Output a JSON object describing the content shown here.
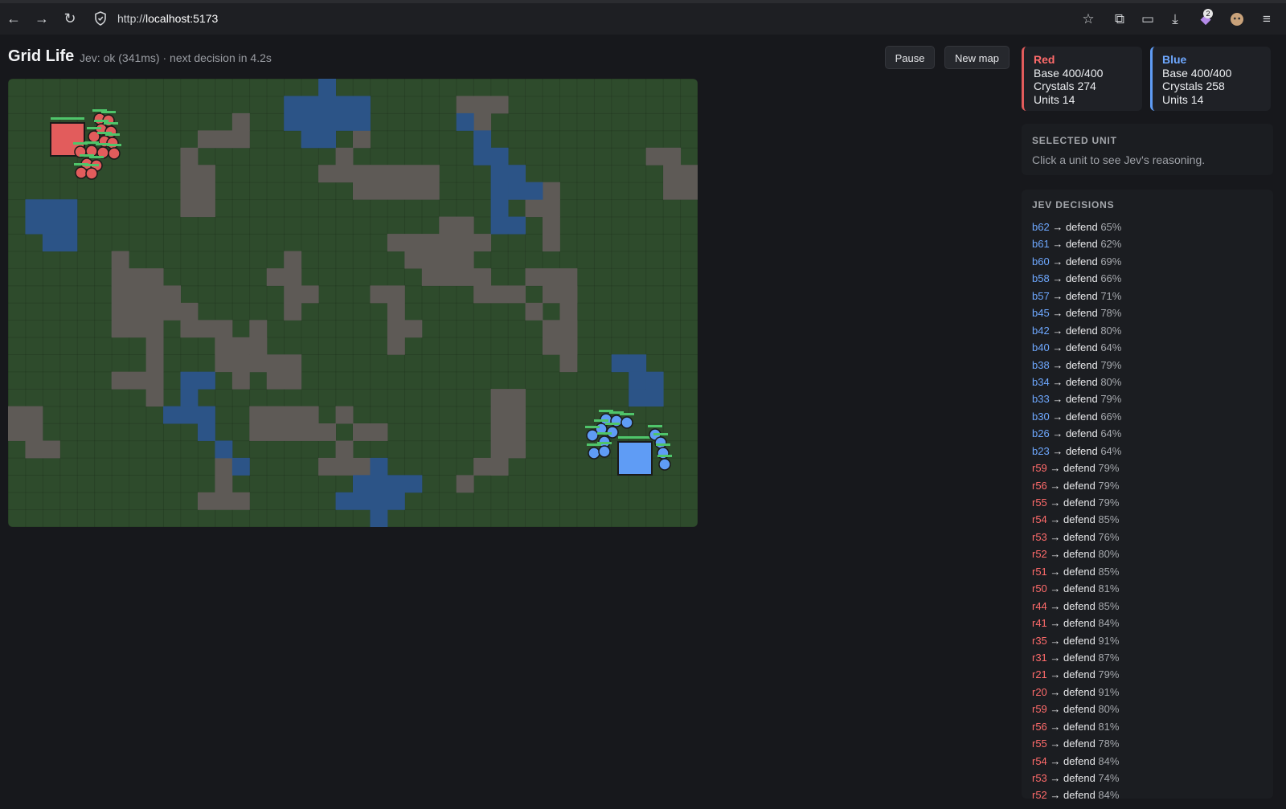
{
  "browser": {
    "url_prefix": "http://",
    "url_host": "localhost:5173",
    "extension_badge": "2",
    "icons": [
      "back-arrow-icon",
      "forward-arrow-icon",
      "reload-icon",
      "shield-icon",
      "bookmark-star-icon",
      "extensions-icon",
      "sidebar-icon",
      "download-icon",
      "extension-badge-icon",
      "profile-avatar-icon",
      "menu-icon"
    ]
  },
  "header": {
    "title": "Grid Life",
    "status": "Jev: ok (341ms) · next decision in 4.2s",
    "pause_label": "Pause",
    "new_map_label": "New map"
  },
  "teams": {
    "red": {
      "name": "Red",
      "base": "Base 400/400",
      "crystals": "Crystals 274",
      "units": "Units 14",
      "color": "#e25c5c"
    },
    "blue": {
      "name": "Blue",
      "base": "Base 400/400",
      "crystals": "Crystals 258",
      "units": "Units 14",
      "color": "#5f9cf5"
    }
  },
  "selected_unit": {
    "heading": "SELECTED UNIT",
    "hint": "Click a unit to see Jev's reasoning."
  },
  "decisions": {
    "heading": "JEV DECISIONS",
    "items": [
      {
        "unit": "b62",
        "action": "defend",
        "pct": "65%"
      },
      {
        "unit": "b61",
        "action": "defend",
        "pct": "62%"
      },
      {
        "unit": "b60",
        "action": "defend",
        "pct": "69%"
      },
      {
        "unit": "b58",
        "action": "defend",
        "pct": "66%"
      },
      {
        "unit": "b57",
        "action": "defend",
        "pct": "71%"
      },
      {
        "unit": "b45",
        "action": "defend",
        "pct": "78%"
      },
      {
        "unit": "b42",
        "action": "defend",
        "pct": "80%"
      },
      {
        "unit": "b40",
        "action": "defend",
        "pct": "64%"
      },
      {
        "unit": "b38",
        "action": "defend",
        "pct": "79%"
      },
      {
        "unit": "b34",
        "action": "defend",
        "pct": "80%"
      },
      {
        "unit": "b33",
        "action": "defend",
        "pct": "79%"
      },
      {
        "unit": "b30",
        "action": "defend",
        "pct": "66%"
      },
      {
        "unit": "b26",
        "action": "defend",
        "pct": "64%"
      },
      {
        "unit": "b23",
        "action": "defend",
        "pct": "64%"
      },
      {
        "unit": "r59",
        "action": "defend",
        "pct": "79%"
      },
      {
        "unit": "r56",
        "action": "defend",
        "pct": "79%"
      },
      {
        "unit": "r55",
        "action": "defend",
        "pct": "79%"
      },
      {
        "unit": "r54",
        "action": "defend",
        "pct": "85%"
      },
      {
        "unit": "r53",
        "action": "defend",
        "pct": "76%"
      },
      {
        "unit": "r52",
        "action": "defend",
        "pct": "80%"
      },
      {
        "unit": "r51",
        "action": "defend",
        "pct": "85%"
      },
      {
        "unit": "r50",
        "action": "defend",
        "pct": "81%"
      },
      {
        "unit": "r44",
        "action": "defend",
        "pct": "85%"
      },
      {
        "unit": "r41",
        "action": "defend",
        "pct": "84%"
      },
      {
        "unit": "r35",
        "action": "defend",
        "pct": "91%"
      },
      {
        "unit": "r31",
        "action": "defend",
        "pct": "87%"
      },
      {
        "unit": "r21",
        "action": "defend",
        "pct": "79%"
      },
      {
        "unit": "r20",
        "action": "defend",
        "pct": "91%"
      },
      {
        "unit": "r59",
        "action": "defend",
        "pct": "80%"
      },
      {
        "unit": "r56",
        "action": "defend",
        "pct": "81%"
      },
      {
        "unit": "r55",
        "action": "defend",
        "pct": "78%"
      },
      {
        "unit": "r54",
        "action": "defend",
        "pct": "84%"
      },
      {
        "unit": "r53",
        "action": "defend",
        "pct": "74%"
      },
      {
        "unit": "r52",
        "action": "defend",
        "pct": "84%"
      }
    ]
  },
  "map_colors": {
    "grass": "#2e4b2c",
    "rock": "#5e5a56",
    "water": "#2c5487"
  }
}
